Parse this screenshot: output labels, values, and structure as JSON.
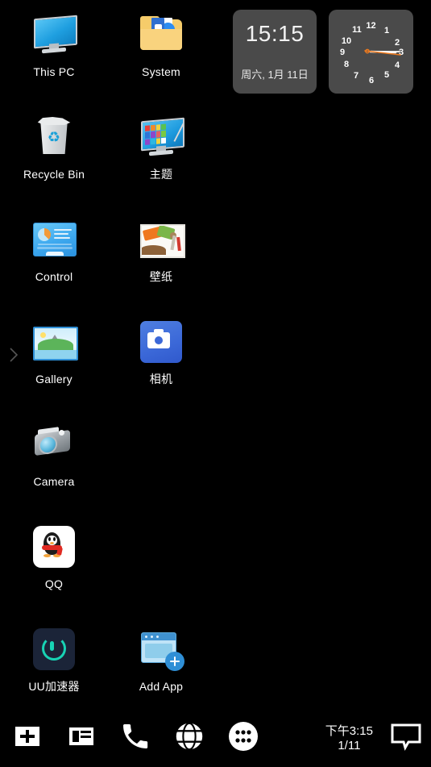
{
  "desktop": {
    "icons": [
      {
        "label": "This PC",
        "icon": "monitor-icon",
        "row": 1,
        "col": 1
      },
      {
        "label": "System",
        "icon": "folder-icon",
        "row": 1,
        "col": 2
      },
      {
        "label": "Recycle Bin",
        "icon": "recycle-bin-icon",
        "row": 2,
        "col": 1
      },
      {
        "label": "主题",
        "icon": "theme-monitor-icon",
        "row": 2,
        "col": 2
      },
      {
        "label": "Control",
        "icon": "control-panel-icon",
        "row": 3,
        "col": 1
      },
      {
        "label": "壁纸",
        "icon": "wallpaper-icon",
        "row": 3,
        "col": 2
      },
      {
        "label": "Gallery",
        "icon": "gallery-icon",
        "row": 4,
        "col": 1
      },
      {
        "label": "相机",
        "icon": "camera-app-icon",
        "row": 4,
        "col": 2
      },
      {
        "label": "Camera",
        "icon": "camera-icon",
        "row": 5,
        "col": 1
      },
      {
        "label": "QQ",
        "icon": "qq-icon",
        "row": 6,
        "col": 1
      },
      {
        "label": "UU加速器",
        "icon": "uu-booster-icon",
        "row": 7,
        "col": 1
      },
      {
        "label": "Add App",
        "icon": "add-app-icon",
        "row": 7,
        "col": 2
      }
    ],
    "page_arrow_icon": "chevron-right-icon"
  },
  "widgets": {
    "digital_clock": {
      "time": "15:15",
      "date": "周六, 1月 11日",
      "background_color": "#4a4a4a"
    },
    "analog_clock": {
      "numbers": [
        "12",
        "1",
        "2",
        "3",
        "4",
        "5",
        "6",
        "7",
        "8",
        "9",
        "10",
        "11"
      ],
      "hour_hand_angle_deg": 92,
      "minute_hand_angle_deg": 90,
      "second_hand_angle_deg": 94,
      "hand_color": "#ffffff",
      "accent_color": "#f07b1e",
      "background_color": "#4a4a4a"
    }
  },
  "dock": {
    "buttons": [
      {
        "name": "add-widget-button",
        "icon": "plus-square-icon"
      },
      {
        "name": "notes-button",
        "icon": "notes-icon"
      },
      {
        "name": "phone-button",
        "icon": "phone-icon"
      },
      {
        "name": "browser-button",
        "icon": "globe-icon"
      },
      {
        "name": "app-drawer-button",
        "icon": "app-drawer-icon"
      }
    ],
    "clock": {
      "time": "下午3:15",
      "date": "1/11"
    },
    "message_icon": "message-bubble-icon",
    "background_color": "#000000"
  },
  "theme": {
    "wallpaper_color": "#000000",
    "label_color": "#ffffff"
  }
}
